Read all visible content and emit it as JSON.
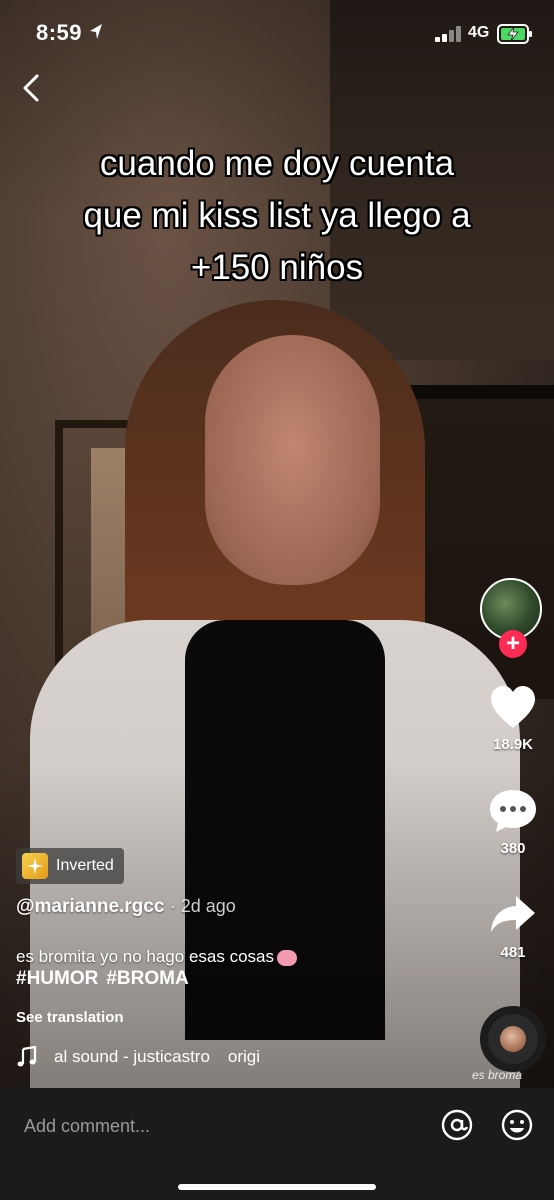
{
  "status_bar": {
    "time": "8:59",
    "network": "4G"
  },
  "video": {
    "caption_lines": [
      "cuando me doy cuenta",
      "que mi kiss list ya llego a",
      "+150 niños"
    ]
  },
  "actions": {
    "likes": "18.9K",
    "comments": "380",
    "shares": "481",
    "follow_symbol": "+"
  },
  "post": {
    "effect_label": "Inverted",
    "username": "@marianne.rgcc",
    "age": "· 2d ago",
    "description": "es bromita yo no hago esas cosas",
    "hashtags": [
      "#HUMOR",
      "#BROMA"
    ],
    "see_translation": "See translation",
    "sound_text": "al sound - justicastro",
    "sound_text_2": "origi",
    "disc_label": "es broma"
  },
  "comment_bar": {
    "placeholder": "Add comment..."
  },
  "colors": {
    "follow": "#fe2c55",
    "comment_bar_bg": "#1b1b1b"
  },
  "icons": [
    "location-arrow-icon",
    "signal-icon",
    "battery-charging-icon",
    "back-chevron-icon",
    "heart-icon",
    "comment-bubble-icon",
    "share-arrow-icon",
    "music-note-icon",
    "at-sign-icon",
    "smiley-icon",
    "effect-sparkle-icon"
  ]
}
